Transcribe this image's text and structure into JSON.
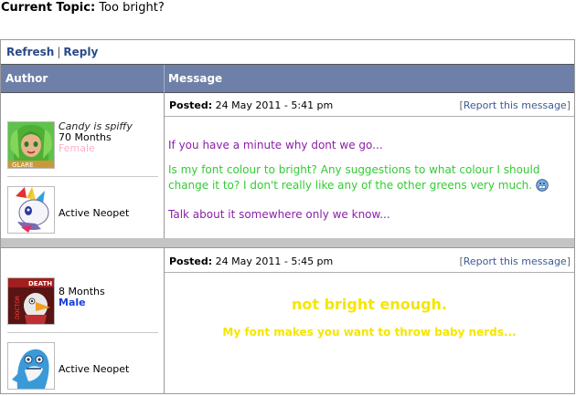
{
  "topic": {
    "label": "Current Topic:",
    "title": "Too bright?"
  },
  "actions": {
    "refresh": "Refresh",
    "separator": "|",
    "reply": "Reply"
  },
  "header": {
    "author": "Author",
    "message": "Message"
  },
  "posts": [
    {
      "author_name": "Candy is spiffy",
      "author_age": "70 Months",
      "author_gender": "Female",
      "pet_status": "Active Neopet",
      "posted_label": "Posted:",
      "posted_time": "24 May 2011 - 5:41 pm",
      "report_open": "[",
      "report": "Report this message",
      "report_close": "]",
      "lines": [
        "If you have a minute why dont we go...",
        "Is my font colour to bright? Any suggestions to what colour I should change it to? I don't really like any of the other greens very much.",
        "Talk about it somewhere only we know..."
      ]
    },
    {
      "author_age": "8 Months",
      "author_gender": "Male",
      "pet_status": "Active Neopet",
      "posted_label": "Posted:",
      "posted_time": "24 May 2011 - 5:45 pm",
      "report_open": "[",
      "report": "Report this message",
      "report_close": "]",
      "lines": [
        "not bright enough.",
        "My font makes you want to throw baby nerds..."
      ]
    }
  ],
  "colors": {
    "header_bg": "#6e80a8",
    "purple_text": "#8b1fa8",
    "green_text": "#32cc32",
    "yellow_text": "#f5e600",
    "female": "#ffb0c8",
    "male": "#1a3fd6"
  },
  "icons": {
    "avatar1": "green-haired-girl-avatar",
    "pet1": "unicorn-pet",
    "avatar2": "death-bird-avatar",
    "pet2": "blue-shark-pet",
    "emoticon": "grin-emoticon"
  }
}
